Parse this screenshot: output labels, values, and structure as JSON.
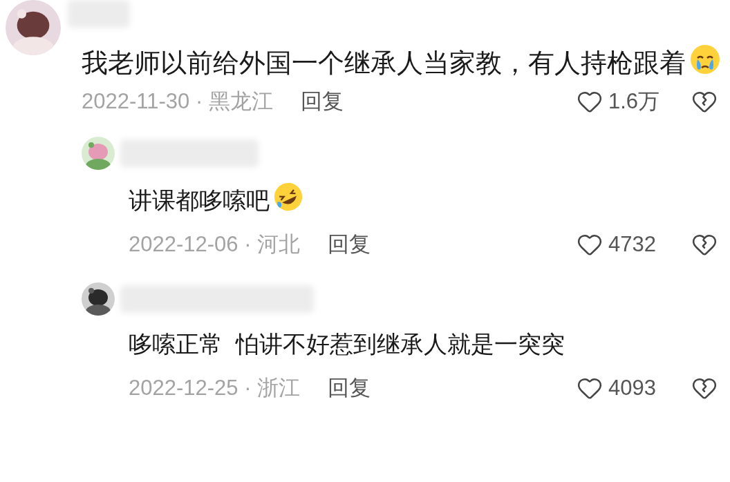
{
  "comment": {
    "text": "我老师以前给外国一个继承人当家教，有人持枪跟着",
    "kind": "crying",
    "date": "2022-11-30 · 黑龙江",
    "reply_label": "回复",
    "likes": "1.6万",
    "replies": [
      {
        "text": "讲课都哆嗦吧",
        "kind": "laughing",
        "date": "2022-12-06 · 河北",
        "reply_label": "回复",
        "likes": "4732"
      },
      {
        "text": "哆嗦正常  怕讲不好惹到继承人就是一突突",
        "date": "2022-12-25 · 浙江",
        "reply_label": "回复",
        "likes": "4093"
      }
    ]
  }
}
